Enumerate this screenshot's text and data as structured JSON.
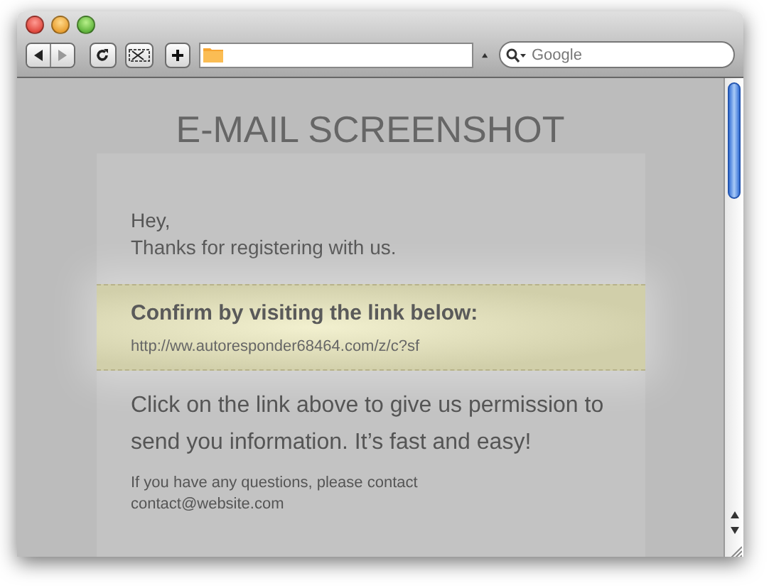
{
  "browser": {
    "search": {
      "placeholder": "Google"
    }
  },
  "page": {
    "heading": "E-MAIL SCREENSHOT",
    "email": {
      "greeting": "Hey,",
      "intro": "Thanks for registering with us.",
      "confirm": {
        "heading": "Confirm by visiting the link below:",
        "link": "http://ww.autoresponder68464.com/z/c?sf"
      },
      "permission": "Click on the link above to give us permission to send you information. It’s fast and easy!",
      "contact_line": "If you have any questions, please contact",
      "contact_email": "contact@website.com"
    }
  }
}
